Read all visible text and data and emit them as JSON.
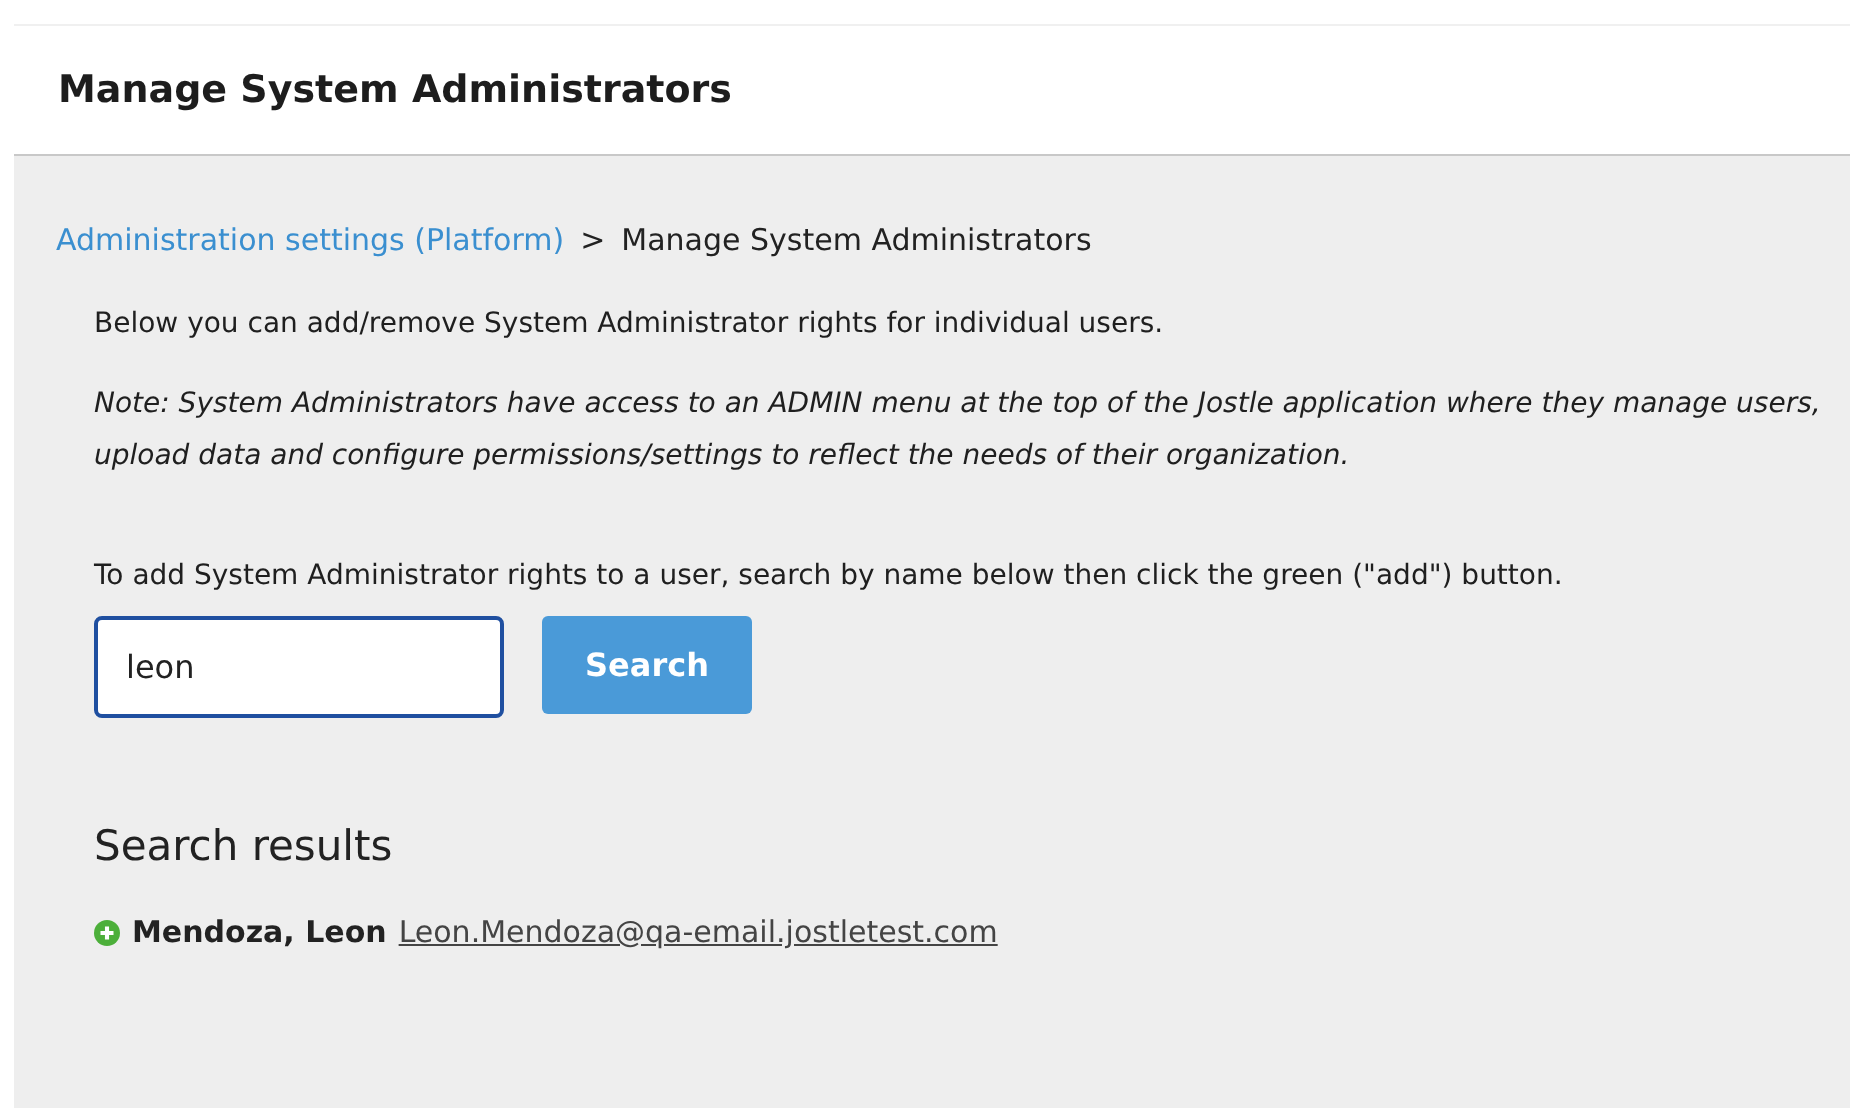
{
  "header": {
    "title": "Manage System Administrators"
  },
  "breadcrumb": {
    "link": "Administration settings (Platform)",
    "separator": ">",
    "current": "Manage System Administrators"
  },
  "intro": "Below you can add/remove System Administrator rights for individual users.",
  "note": "Note: System Administrators have access to an ADMIN menu at the top of the Jostle application where they manage users, upload data and configure permissions/settings to reflect the needs of their organization.",
  "instruction": "To add System Administrator rights to a user, search by name below then click the green (\"add\") button.",
  "search": {
    "value": "leon",
    "button": "Search"
  },
  "results": {
    "title": "Search results",
    "items": [
      {
        "name": "Mendoza, Leon",
        "email": "Leon.Mendoza@qa-email.jostletest.com"
      }
    ]
  }
}
